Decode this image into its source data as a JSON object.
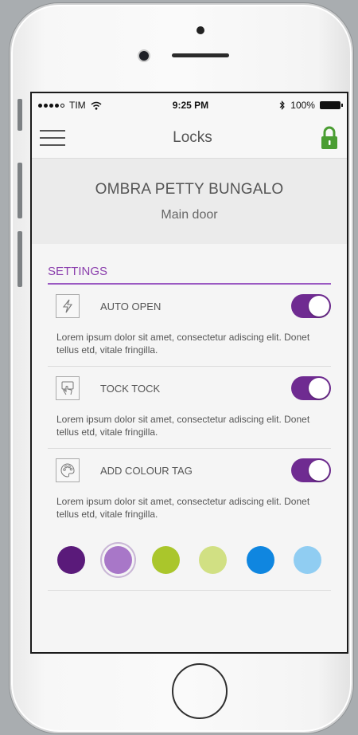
{
  "status": {
    "carrier": "TIM",
    "time": "9:25 PM",
    "battery": "100%"
  },
  "nav": {
    "title": "Locks"
  },
  "lock": {
    "location": "OMBRA PETTY BUNGALO",
    "door": "Main door"
  },
  "settings": {
    "title": "SETTINGS",
    "items": [
      {
        "icon": "lightning-icon",
        "label": "AUTO OPEN",
        "enabled": true,
        "description": "Lorem ipsum dolor sit amet, consectetur adiscing elit. Donet tellus etd, vitale fringilla."
      },
      {
        "icon": "tap-hand-icon",
        "label": "TOCK TOCK",
        "enabled": true,
        "description": "Lorem ipsum dolor sit amet, consectetur adiscing elit. Donet tellus etd, vitale fringilla."
      },
      {
        "icon": "palette-icon",
        "label": "ADD COLOUR TAG",
        "enabled": true,
        "description": "Lorem ipsum dolor sit amet, consectetur adiscing elit. Donet tellus etd, vitale fringilla."
      }
    ]
  },
  "colour_tags": {
    "options": [
      "#5a1a7a",
      "#a877c8",
      "#aac62b",
      "#d1e083",
      "#0f86e0",
      "#90cdf2"
    ],
    "selected_index": 1
  },
  "colors": {
    "accent": "#8b3fad",
    "toggle_on": "#6f2b91",
    "lock_green": "#4a9d32"
  }
}
